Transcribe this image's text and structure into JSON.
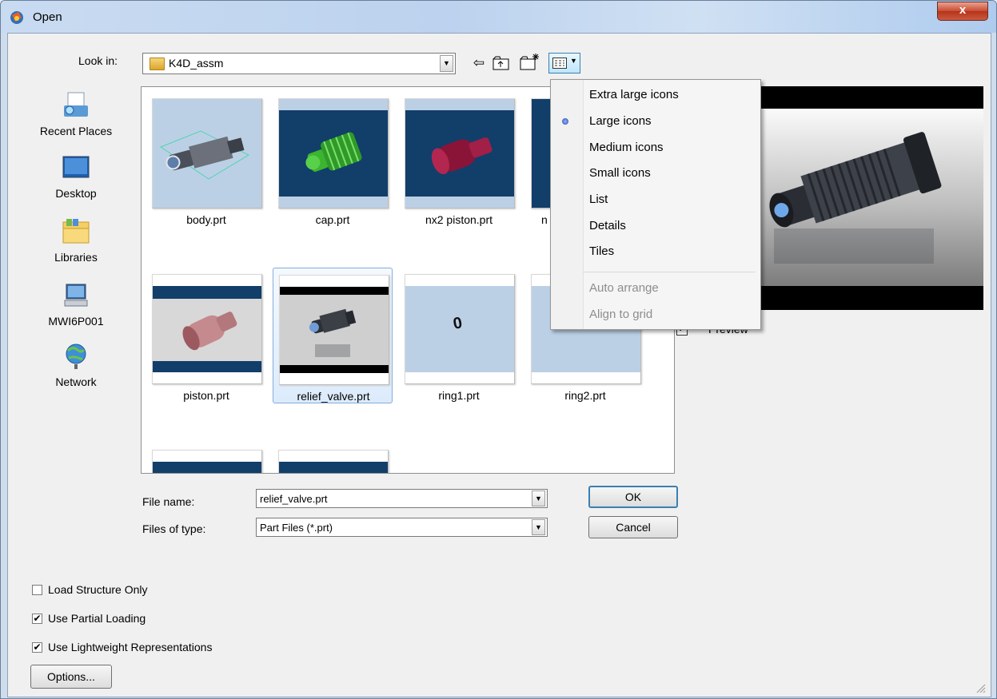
{
  "window": {
    "title": "Open",
    "close_label": "x"
  },
  "toolbar": {
    "look_in_label": "Look in:",
    "look_in_value": "K4D_assm",
    "back_icon": "back-arrow-icon",
    "up_icon": "up-folder-icon",
    "new_folder_icon": "new-folder-icon",
    "view_icon": "view-menu-icon"
  },
  "places": [
    {
      "label": "Recent Places",
      "icon": "recent-places-icon"
    },
    {
      "label": "Desktop",
      "icon": "desktop-icon"
    },
    {
      "label": "Libraries",
      "icon": "libraries-icon"
    },
    {
      "label": "MWI6P001",
      "icon": "computer-icon"
    },
    {
      "label": "Network",
      "icon": "network-icon"
    }
  ],
  "files": [
    {
      "name": "body.prt"
    },
    {
      "name": "cap.prt"
    },
    {
      "name": "nx2 piston.prt"
    },
    {
      "name": "n"
    },
    {
      "name": "piston.prt"
    },
    {
      "name": "relief_valve.prt",
      "selected": true
    },
    {
      "name": "ring1.prt"
    },
    {
      "name": "ring2.prt"
    }
  ],
  "ring1_glyph": "0",
  "preview_label": "Preview",
  "view_menu": {
    "items": [
      {
        "label": "Extra large icons",
        "selected": false
      },
      {
        "label": "Large icons",
        "selected": true
      },
      {
        "label": "Medium icons",
        "selected": false
      },
      {
        "label": "Small icons",
        "selected": false
      },
      {
        "label": "List",
        "selected": false
      },
      {
        "label": "Details",
        "selected": false
      },
      {
        "label": "Tiles",
        "selected": false
      }
    ],
    "disabled_items": [
      {
        "label": "Auto arrange"
      },
      {
        "label": "Align to grid"
      }
    ]
  },
  "form": {
    "file_name_label": "File name:",
    "file_name_value": "relief_valve.prt",
    "file_type_label": "Files of type:",
    "file_type_value": "Part Files (*.prt)",
    "ok_label": "OK",
    "cancel_label": "Cancel"
  },
  "options": [
    {
      "label": "Load Structure Only",
      "checked": false
    },
    {
      "label": "Use Partial Loading",
      "checked": true
    },
    {
      "label": "Use Lightweight Representations",
      "checked": true
    }
  ],
  "options_button": "Options...",
  "colors": {
    "thumb_blue": "#123e6a",
    "thumb_light": "#bcd0e5",
    "selection": "#84acdd"
  }
}
